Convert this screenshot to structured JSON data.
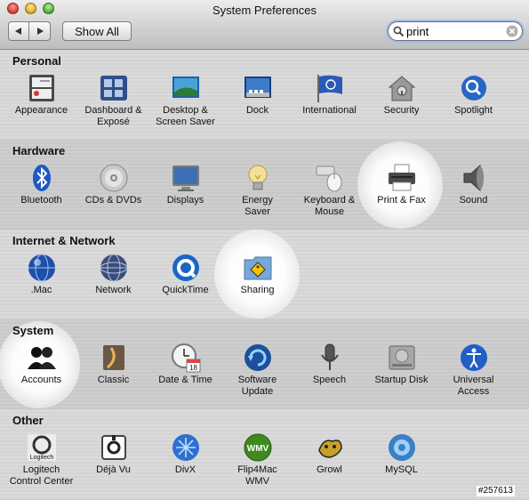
{
  "window": {
    "title": "System Preferences",
    "show_all_label": "Show All",
    "back_icon": "back-arrow-icon",
    "forward_icon": "forward-arrow-icon"
  },
  "search": {
    "value": "print",
    "icon": "magnifier-icon",
    "clear_icon": "clear-x-icon"
  },
  "sections": {
    "personal": {
      "title": "Personal",
      "items": [
        {
          "label": "Appearance",
          "icon": "appearance-icon"
        },
        {
          "label": "Dashboard &\nExposé",
          "icon": "dashboard-expose-icon"
        },
        {
          "label": "Desktop &\nScreen Saver",
          "icon": "desktop-screensaver-icon"
        },
        {
          "label": "Dock",
          "icon": "dock-icon"
        },
        {
          "label": "International",
          "icon": "international-flag-icon"
        },
        {
          "label": "Security",
          "icon": "security-house-icon"
        },
        {
          "label": "Spotlight",
          "icon": "spotlight-magnifier-icon"
        }
      ]
    },
    "hardware": {
      "title": "Hardware",
      "items": [
        {
          "label": "Bluetooth",
          "icon": "bluetooth-icon"
        },
        {
          "label": "CDs & DVDs",
          "icon": "cd-dvd-icon"
        },
        {
          "label": "Displays",
          "icon": "display-monitor-icon"
        },
        {
          "label": "Energy\nSaver",
          "icon": "light-bulb-icon"
        },
        {
          "label": "Keyboard &\nMouse",
          "icon": "keyboard-mouse-icon"
        },
        {
          "label": "Print & Fax",
          "icon": "printer-icon"
        },
        {
          "label": "Sound",
          "icon": "speaker-icon"
        }
      ]
    },
    "internet": {
      "title": "Internet & Network",
      "items": [
        {
          "label": ".Mac",
          "icon": "dotmac-globe-icon"
        },
        {
          "label": "Network",
          "icon": "network-globe-icon"
        },
        {
          "label": "QuickTime",
          "icon": "quicktime-icon"
        },
        {
          "label": "Sharing",
          "icon": "sharing-folder-icon"
        }
      ]
    },
    "system": {
      "title": "System",
      "items": [
        {
          "label": "Accounts",
          "icon": "accounts-people-icon"
        },
        {
          "label": "Classic",
          "icon": "classic-icon"
        },
        {
          "label": "Date & Time",
          "icon": "clock-calendar-icon",
          "calendar_day": "18"
        },
        {
          "label": "Software\nUpdate",
          "icon": "software-update-icon"
        },
        {
          "label": "Speech",
          "icon": "microphone-icon"
        },
        {
          "label": "Startup Disk",
          "icon": "hard-disk-icon"
        },
        {
          "label": "Universal\nAccess",
          "icon": "universal-access-icon"
        }
      ]
    },
    "other": {
      "title": "Other",
      "items": [
        {
          "label": "Logitech\nControl Center",
          "icon": "logitech-icon",
          "icon_text": "Logitech"
        },
        {
          "label": "Déjà Vu",
          "icon": "dejavu-icon"
        },
        {
          "label": "DivX",
          "icon": "divx-icon"
        },
        {
          "label": "Flip4Mac\nWMV",
          "icon": "flip4mac-icon",
          "icon_text": "WMV"
        },
        {
          "label": "Growl",
          "icon": "growl-icon"
        },
        {
          "label": "MySQL",
          "icon": "mysql-icon"
        }
      ]
    }
  },
  "watermark": "#257613",
  "colors": {
    "highlight": "#ffffff",
    "close": "#e0443e",
    "minimize": "#e8b02e",
    "zoom": "#58b53e",
    "search_focus": "#9fbfe6"
  }
}
